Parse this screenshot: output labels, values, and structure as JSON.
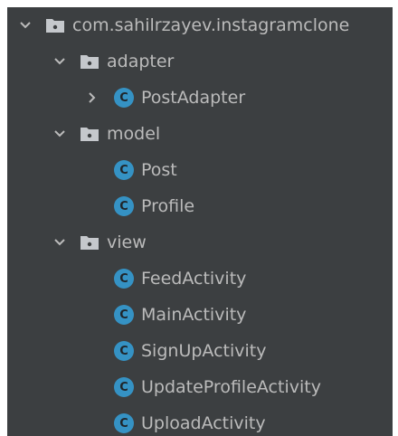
{
  "tree": {
    "package": {
      "label": "com.sahilrzayev.instagramclone",
      "expanded": true,
      "icon": "package-folder-icon"
    },
    "adapter": {
      "label": "adapter",
      "expanded": true,
      "icon": "package-folder-icon"
    },
    "post_adapter": {
      "label": "PostAdapter",
      "expanded": false,
      "icon": "class-icon",
      "icon_letter": "C"
    },
    "model": {
      "label": "model",
      "expanded": true,
      "icon": "package-folder-icon"
    },
    "post": {
      "label": "Post",
      "icon": "class-icon",
      "icon_letter": "C"
    },
    "profile": {
      "label": "Profile",
      "icon": "class-icon",
      "icon_letter": "C"
    },
    "view": {
      "label": "view",
      "expanded": true,
      "icon": "package-folder-icon"
    },
    "feed_activity": {
      "label": "FeedActivity",
      "icon": "class-icon",
      "icon_letter": "C"
    },
    "main_activity": {
      "label": "MainActivity",
      "icon": "class-icon",
      "icon_letter": "C"
    },
    "signup_activity": {
      "label": "SignUpActivity",
      "icon": "class-icon",
      "icon_letter": "C"
    },
    "update_profile_activity": {
      "label": "UpdateProfileActivity",
      "icon": "class-icon",
      "icon_letter": "C"
    },
    "upload_activity": {
      "label": "UploadActivity",
      "icon": "class-icon",
      "icon_letter": "C"
    }
  },
  "colors": {
    "background": "#3c3f41",
    "text": "#bbbbbb",
    "class_icon": "#3592c4",
    "folder_icon": "#c5c8cc"
  }
}
